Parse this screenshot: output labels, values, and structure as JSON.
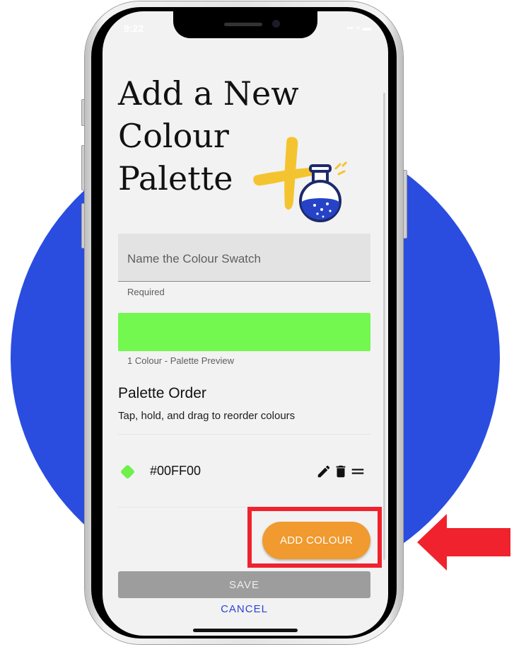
{
  "status_bar": {
    "time": "9:22",
    "icons": "▪▪ ≈ ▬"
  },
  "page": {
    "title_lines": [
      "Add a New",
      "Colour",
      "Palette"
    ]
  },
  "form": {
    "name_placeholder": "Name the Colour Swatch",
    "name_helper": "Required",
    "preview_color": "#72F84F",
    "preview_caption": "1 Colour - Palette Preview"
  },
  "palette_order": {
    "heading": "Palette Order",
    "subtitle": "Tap, hold, and drag to reorder colours",
    "items": [
      {
        "hex": "#00FF00",
        "swatch_color": "#6FF04A",
        "actions": [
          "edit-icon",
          "trash-icon",
          "drag-handle-icon"
        ]
      }
    ]
  },
  "buttons": {
    "add_colour": "ADD COLOUR",
    "save": "SAVE",
    "cancel": "CANCEL"
  },
  "colors": {
    "background_circle": "#2A4DE0",
    "accent_orange": "#F09A2F",
    "link_blue": "#2A45D6",
    "highlight_red": "#F0222E"
  }
}
